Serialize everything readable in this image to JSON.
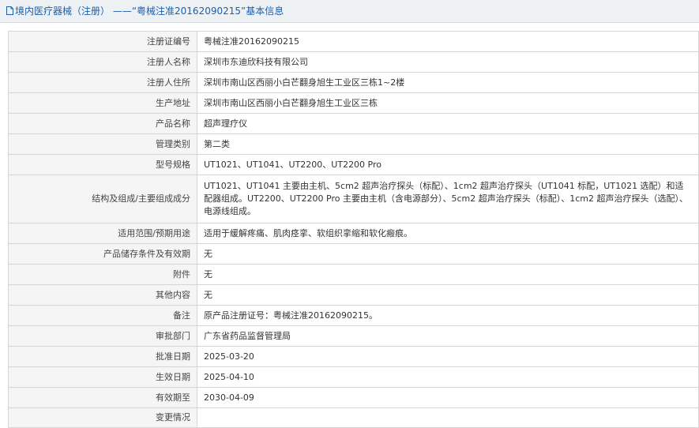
{
  "header": {
    "title": "境内医疗器械（注册） ——“粤械注准20162090215”基本信息",
    "icon": "document-icon",
    "color": "#1d5fa8"
  },
  "rows": [
    {
      "label": "注册证编号",
      "value": "粤械注准20162090215"
    },
    {
      "label": "注册人名称",
      "value": "深圳市东迪欣科技有限公司"
    },
    {
      "label": "注册人住所",
      "value": "深圳市南山区西丽小白芒翻身旭生工业区三栋1~2楼"
    },
    {
      "label": "生产地址",
      "value": "深圳市南山区西丽小白芒翻身旭生工业区三栋"
    },
    {
      "label": "产品名称",
      "value": "超声理疗仪"
    },
    {
      "label": "管理类别",
      "value": "第二类"
    },
    {
      "label": "型号规格",
      "value": "UT1021、UT1041、UT2200、UT2200 Pro"
    },
    {
      "label": "结构及组成/主要组成成分",
      "value": "UT1021、UT1041 主要由主机、5cm2 超声治疗探头（标配）、1cm2 超声治疗探头（UT1041 标配，UT1021 选配）和适配器组成。UT2200、UT2200 Pro 主要由主机（含电源部分）、5cm2 超声治疗探头（标配）、1cm2 超声治疗探头（选配）、电源线组成。"
    },
    {
      "label": "适用范围/预期用途",
      "value": "适用于缓解疼痛、肌肉痉挛、软组织挛缩和软化瘢痕。"
    },
    {
      "label": "产品储存条件及有效期",
      "value": "无"
    },
    {
      "label": "附件",
      "value": "无"
    },
    {
      "label": "其他内容",
      "value": "无"
    },
    {
      "label": "备注",
      "value": "原产品注册证号：粤械注准20162090215。"
    },
    {
      "label": "审批部门",
      "value": "广东省药品监督管理局"
    },
    {
      "label": "批准日期",
      "value": "2025-03-20"
    },
    {
      "label": "生效日期",
      "value": "2025-04-10"
    },
    {
      "label": "有效期至",
      "value": "2030-04-09"
    },
    {
      "label": "变更情况",
      "value": ""
    }
  ]
}
